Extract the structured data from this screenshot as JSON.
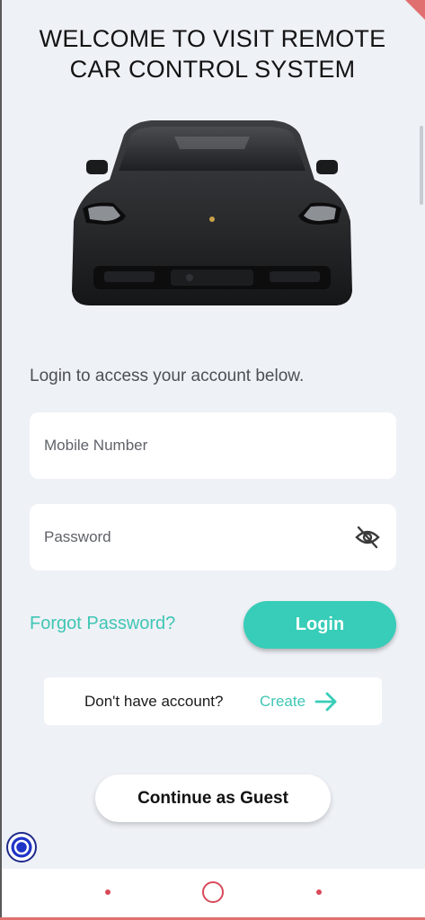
{
  "header": {
    "title": "WELCOME TO VISIT REMOTE\nCAR CONTROL SYSTEM"
  },
  "hero": {
    "image": "car-front-image"
  },
  "login": {
    "subtitle": "Login to access your account below.",
    "mobile_placeholder": "Mobile Number",
    "password_placeholder": "Password",
    "password_toggle_icon": "eye-off-icon",
    "forgot_label": "Forgot Password?",
    "login_label": "Login"
  },
  "signup": {
    "prompt": "Don't have account?",
    "create_label": "Create",
    "arrow_icon": "arrow-right-icon"
  },
  "guest": {
    "label": "Continue as Guest"
  },
  "system_nav": {
    "icons": [
      "back-dot-icon",
      "home-circle-icon",
      "recents-dot-icon"
    ]
  },
  "colors": {
    "accent": "#37cdb8",
    "accent_text": "#3fc6b5",
    "background": "#eef1f6",
    "nav_icon": "#d84a5a"
  }
}
